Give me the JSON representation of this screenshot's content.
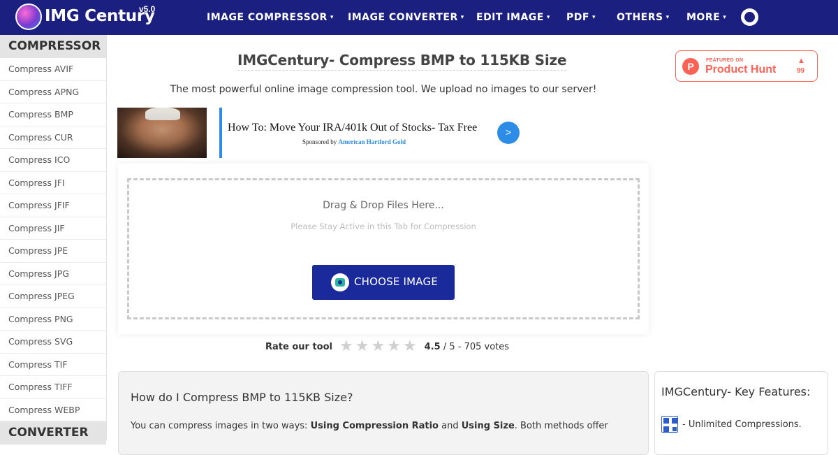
{
  "header": {
    "brand": "IMG Century",
    "version": "v5.0",
    "nav": [
      {
        "label": "IMAGE COMPRESSOR"
      },
      {
        "label": "IMAGE CONVERTER"
      },
      {
        "label": "EDIT IMAGE"
      },
      {
        "label": "PDF"
      },
      {
        "label": "OTHERS"
      },
      {
        "label": "MORE"
      }
    ],
    "caret_icon": "▾"
  },
  "sidebar": {
    "section_compressor": "COMPRESSOR",
    "items": [
      {
        "label": "Compress AVIF"
      },
      {
        "label": "Compress APNG"
      },
      {
        "label": "Compress BMP"
      },
      {
        "label": "Compress CUR"
      },
      {
        "label": "Compress ICO"
      },
      {
        "label": "Compress JFI"
      },
      {
        "label": "Compress JFIF"
      },
      {
        "label": "Compress JIF"
      },
      {
        "label": "Compress JPE"
      },
      {
        "label": "Compress JPG"
      },
      {
        "label": "Compress JPEG"
      },
      {
        "label": "Compress PNG"
      },
      {
        "label": "Compress SVG"
      },
      {
        "label": "Compress TIF"
      },
      {
        "label": "Compress TIFF"
      },
      {
        "label": "Compress WEBP"
      }
    ],
    "section_converter": "CONVERTER"
  },
  "main": {
    "title": "IMGCentury- Compress BMP to 115KB Size",
    "subtitle": "The most powerful online image compression tool. We upload no images to our server!"
  },
  "product_hunt": {
    "featured": "FEATURED ON",
    "name": "Product Hunt",
    "logo_letter": "P",
    "arrow": "▲",
    "count": "99"
  },
  "ad": {
    "headline": "How To: Move Your IRA/401k Out of Stocks- Tax Free",
    "sponsored_prefix": "Sponsored by",
    "sponsor": "American Hartford Gold",
    "arrow": ">"
  },
  "upload": {
    "drop_text": "Drag & Drop Files Here...",
    "stay_text": "Please Stay Active in this Tab for Compression",
    "button_label": "CHOOSE IMAGE"
  },
  "rating": {
    "label": "Rate our tool",
    "stars": 5,
    "star_glyph": "★",
    "score": "4.5",
    "rest": "/ 5 - 705 votes"
  },
  "faq": {
    "title": "How do I Compress BMP to 115KB Size?",
    "body_start": "You can compress images in two ways:",
    "method_one": "Using Compression Ratio",
    "joiner": "and",
    "method_two": "Using Size",
    "body_end": ". Both methods offer"
  },
  "features": {
    "title": "IMGCentury- Key Features:",
    "first": "- Unlimited Compressions."
  },
  "colors": {
    "header_bg": "#1b2080",
    "button_bg": "#1b2a9a",
    "product_hunt": "#ff6154",
    "ad_accent": "#2d8ce6"
  }
}
